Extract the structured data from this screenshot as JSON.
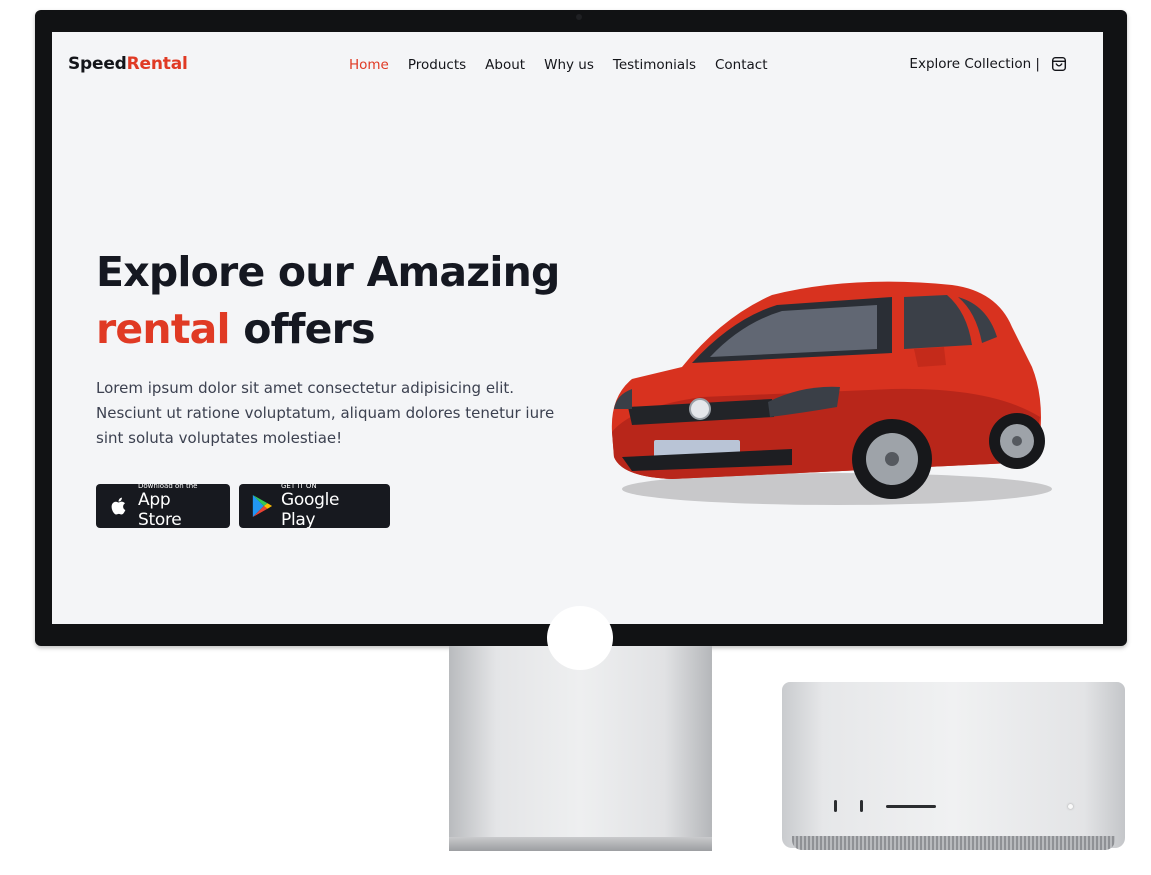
{
  "brand": {
    "name_main": "Speed",
    "name_accent": "Rental",
    "accent_color": "#e03a24"
  },
  "nav": {
    "items": [
      {
        "label": "Home",
        "active": true
      },
      {
        "label": "Products",
        "active": false
      },
      {
        "label": "About",
        "active": false
      },
      {
        "label": "Why us",
        "active": false
      },
      {
        "label": "Testimonials",
        "active": false
      },
      {
        "label": "Contact",
        "active": false
      }
    ],
    "cta_label": "Explore Collection |",
    "cart_icon": "shopping-bag-icon"
  },
  "hero": {
    "title_line1": "Explore our Amazing",
    "title_accent": "rental",
    "title_rest": "offers",
    "description": "Lorem ipsum dolor sit amet consectetur adipisicing elit. Nesciunt ut ratione voluptatum, aliquam dolores tenetur iure sint soluta voluptates molestiae!",
    "image": "red-hatchback-car"
  },
  "store_buttons": {
    "apple": {
      "small": "Download on the",
      "big": "App Store",
      "icon": "apple-icon"
    },
    "google": {
      "small": "GET IT ON",
      "big": "Google Play",
      "icon": "google-play-icon"
    }
  }
}
